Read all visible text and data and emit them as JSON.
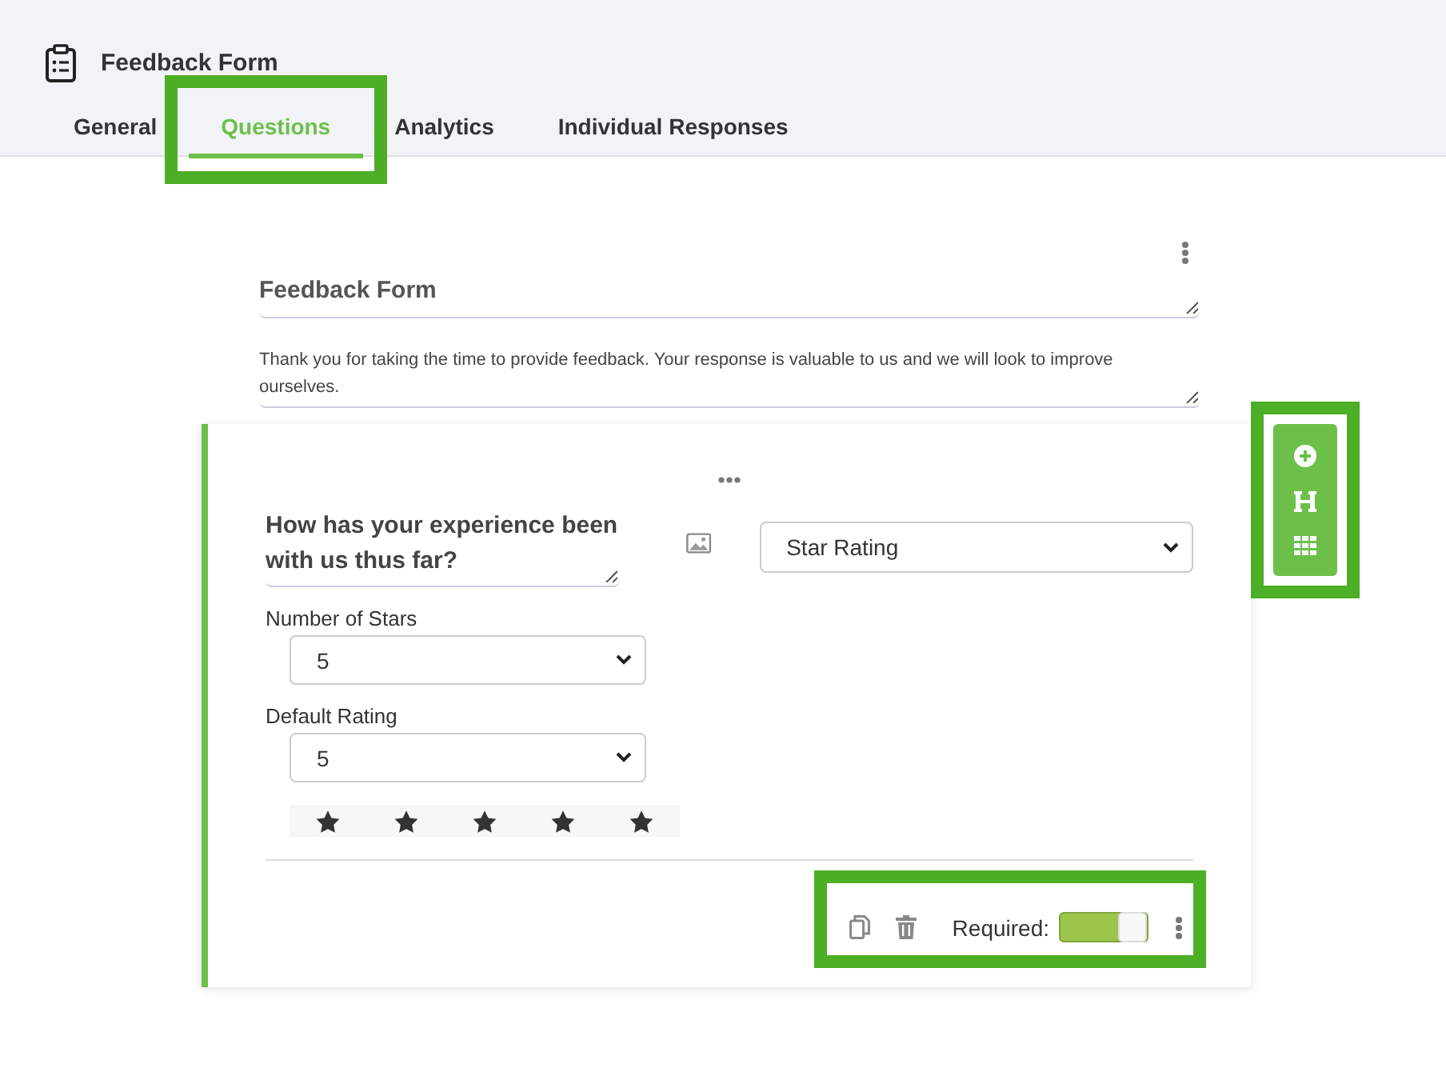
{
  "header": {
    "title": "Feedback Form"
  },
  "tabs": [
    {
      "label": "General",
      "selected": false,
      "highlighted": false
    },
    {
      "label": "Questions",
      "selected": true,
      "highlighted": true
    },
    {
      "label": "Analytics",
      "selected": false,
      "highlighted": false
    },
    {
      "label": "Individual Responses",
      "selected": false,
      "highlighted": false
    }
  ],
  "form": {
    "title": "Feedback Form",
    "description": "Thank you for taking the time to provide feedback. Your response is valuable to us and we will look to improve ourselves."
  },
  "question": {
    "text": "How has your experience been with us thus far?",
    "type": "Star Rating",
    "fields": [
      {
        "label": "Number of Stars",
        "value": "5"
      },
      {
        "label": "Default Rating",
        "value": "5"
      }
    ],
    "rating": {
      "stars": 5
    },
    "footer": {
      "required_label": "Required:",
      "required": true,
      "highlighted": true
    }
  },
  "side_toolbar": {
    "highlighted": true
  }
}
